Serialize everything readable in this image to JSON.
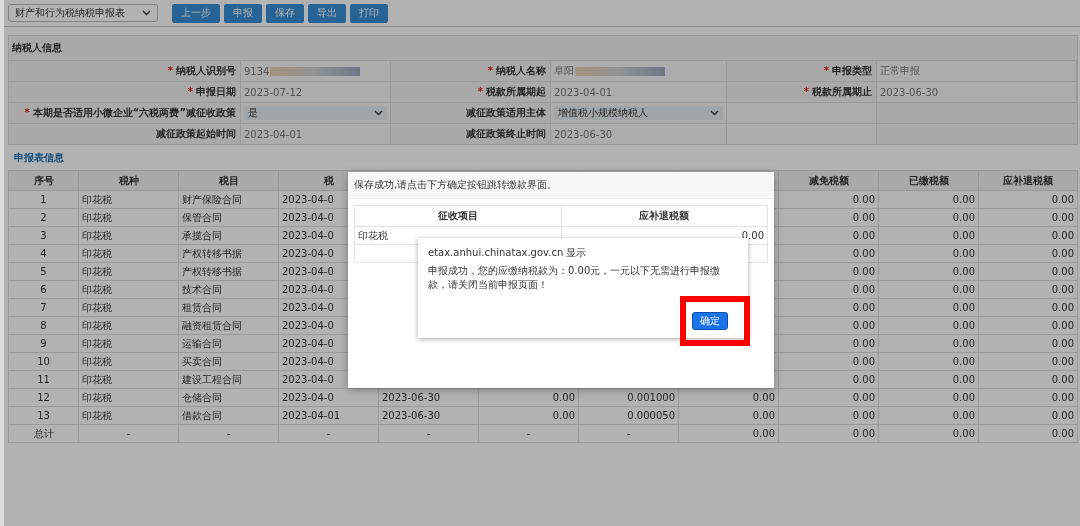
{
  "toolbar": {
    "form_select": "财产和行为税纳税申报表",
    "buttons": [
      "上一步",
      "申报",
      "保存",
      "导出",
      "打印"
    ]
  },
  "taxpayer_section": {
    "title": "纳税人信息",
    "rows": [
      {
        "cells": [
          {
            "required_mark": "*",
            "label": "纳税人识别号",
            "value": "9134",
            "redacted": true,
            "kind": "text"
          },
          {
            "required_mark": "*",
            "label": "纳税人名称",
            "value": "阜阳",
            "redacted": true,
            "kind": "text"
          },
          {
            "required_mark": "*",
            "label": "申报类型",
            "value": "正常申报",
            "redacted": false,
            "kind": "text"
          }
        ]
      },
      {
        "cells": [
          {
            "required_mark": "*",
            "label": "申报日期",
            "value": "2023-07-12",
            "redacted": false,
            "kind": "text"
          },
          {
            "required_mark": "*",
            "label": "税款所属期起",
            "value": "2023-04-01",
            "redacted": false,
            "kind": "text"
          },
          {
            "required_mark": "*",
            "label": "税款所属期止",
            "value": "2023-06-30",
            "redacted": false,
            "kind": "text"
          }
        ]
      },
      {
        "cells": [
          {
            "required_mark": "*",
            "label": "本期是否适用小微企业“六税两费”减征收政策",
            "value": "是",
            "kind": "select"
          },
          {
            "label": "减征政策适用主体",
            "value": "增值税小规模纳税人",
            "kind": "select"
          }
        ]
      },
      {
        "cells": [
          {
            "label": "减征政策起始时间",
            "value": "2023-04-01",
            "redacted": false,
            "kind": "text"
          },
          {
            "label": "减征政策终止时间",
            "value": "2023-06-30",
            "redacted": false,
            "kind": "text"
          }
        ]
      }
    ]
  },
  "declaration_section": {
    "title": "申报表信息",
    "table": {
      "columns": [
        "序号",
        "税种",
        "税目",
        "税",
        null,
        null,
        null,
        null,
        "减免税额",
        "已缴税额",
        "应补退税额"
      ],
      "rows": [
        [
          "1",
          "印花税",
          "财产保险合同",
          "2023-04-0",
          null,
          null,
          null,
          null,
          "0.00",
          "0.00",
          "0.00"
        ],
        [
          "2",
          "印花税",
          "保管合同",
          "2023-04-0",
          null,
          null,
          null,
          null,
          "0.00",
          "0.00",
          "0.00"
        ],
        [
          "3",
          "印花税",
          "承揽合同",
          "2023-04-0",
          null,
          null,
          null,
          null,
          "0.00",
          "0.00",
          "0.00"
        ],
        [
          "4",
          "印花税",
          "产权转移书据",
          "2023-04-0",
          null,
          null,
          null,
          null,
          "0.00",
          "0.00",
          "0.00"
        ],
        [
          "5",
          "印花税",
          "产权转移书据",
          "2023-04-0",
          null,
          null,
          null,
          null,
          "0.00",
          "0.00",
          "0.00"
        ],
        [
          "6",
          "印花税",
          "技术合同",
          "2023-04-0",
          null,
          null,
          null,
          null,
          "0.00",
          "0.00",
          "0.00"
        ],
        [
          "7",
          "印花税",
          "租赁合同",
          "2023-04-0",
          null,
          null,
          null,
          null,
          "0.00",
          "0.00",
          "0.00"
        ],
        [
          "8",
          "印花税",
          "融资租赁合同",
          "2023-04-0",
          null,
          null,
          null,
          null,
          "0.00",
          "0.00",
          "0.00"
        ],
        [
          "9",
          "印花税",
          "运输合同",
          "2023-04-0",
          null,
          null,
          null,
          null,
          "0.00",
          "0.00",
          "0.00"
        ],
        [
          "10",
          "印花税",
          "买卖合同",
          "2023-04-0",
          null,
          null,
          null,
          null,
          "0.00",
          "0.00",
          "0.00"
        ],
        [
          "11",
          "印花税",
          "建设工程合同",
          "2023-04-0",
          null,
          null,
          null,
          null,
          "0.00",
          "0.00",
          "0.00"
        ],
        [
          "12",
          "印花税",
          "仓储合同",
          "2023-04-0",
          "2023-06-30",
          "0.00",
          "0.001000",
          "0.00",
          "0.00",
          "0.00",
          "0.00"
        ],
        [
          "13",
          "印花税",
          "借款合同",
          "2023-04-01",
          "2023-06-30",
          "0.00",
          "0.000050",
          "0.00",
          "0.00",
          "0.00",
          "0.00"
        ]
      ],
      "total": [
        "总计",
        "-",
        "-",
        "-",
        "-",
        "-",
        "-",
        "0.00",
        "0.00",
        "0.00",
        "0.00"
      ]
    }
  },
  "modal": {
    "message": "保存成功,请点击下方确定按钮跳转缴款界面。",
    "table": {
      "columns": [
        "征收项目",
        "应补退税额"
      ],
      "rows": [
        [
          "印花税",
          "0.00"
        ]
      ]
    }
  },
  "alert": {
    "title": "etax.anhui.chinatax.gov.cn 显示",
    "message": "申报成功，您的应缴纳税款为：0.00元，一元以下无需进行申报缴款，请关闭当前申报页面！",
    "button": "确定",
    "highlighted": true
  }
}
